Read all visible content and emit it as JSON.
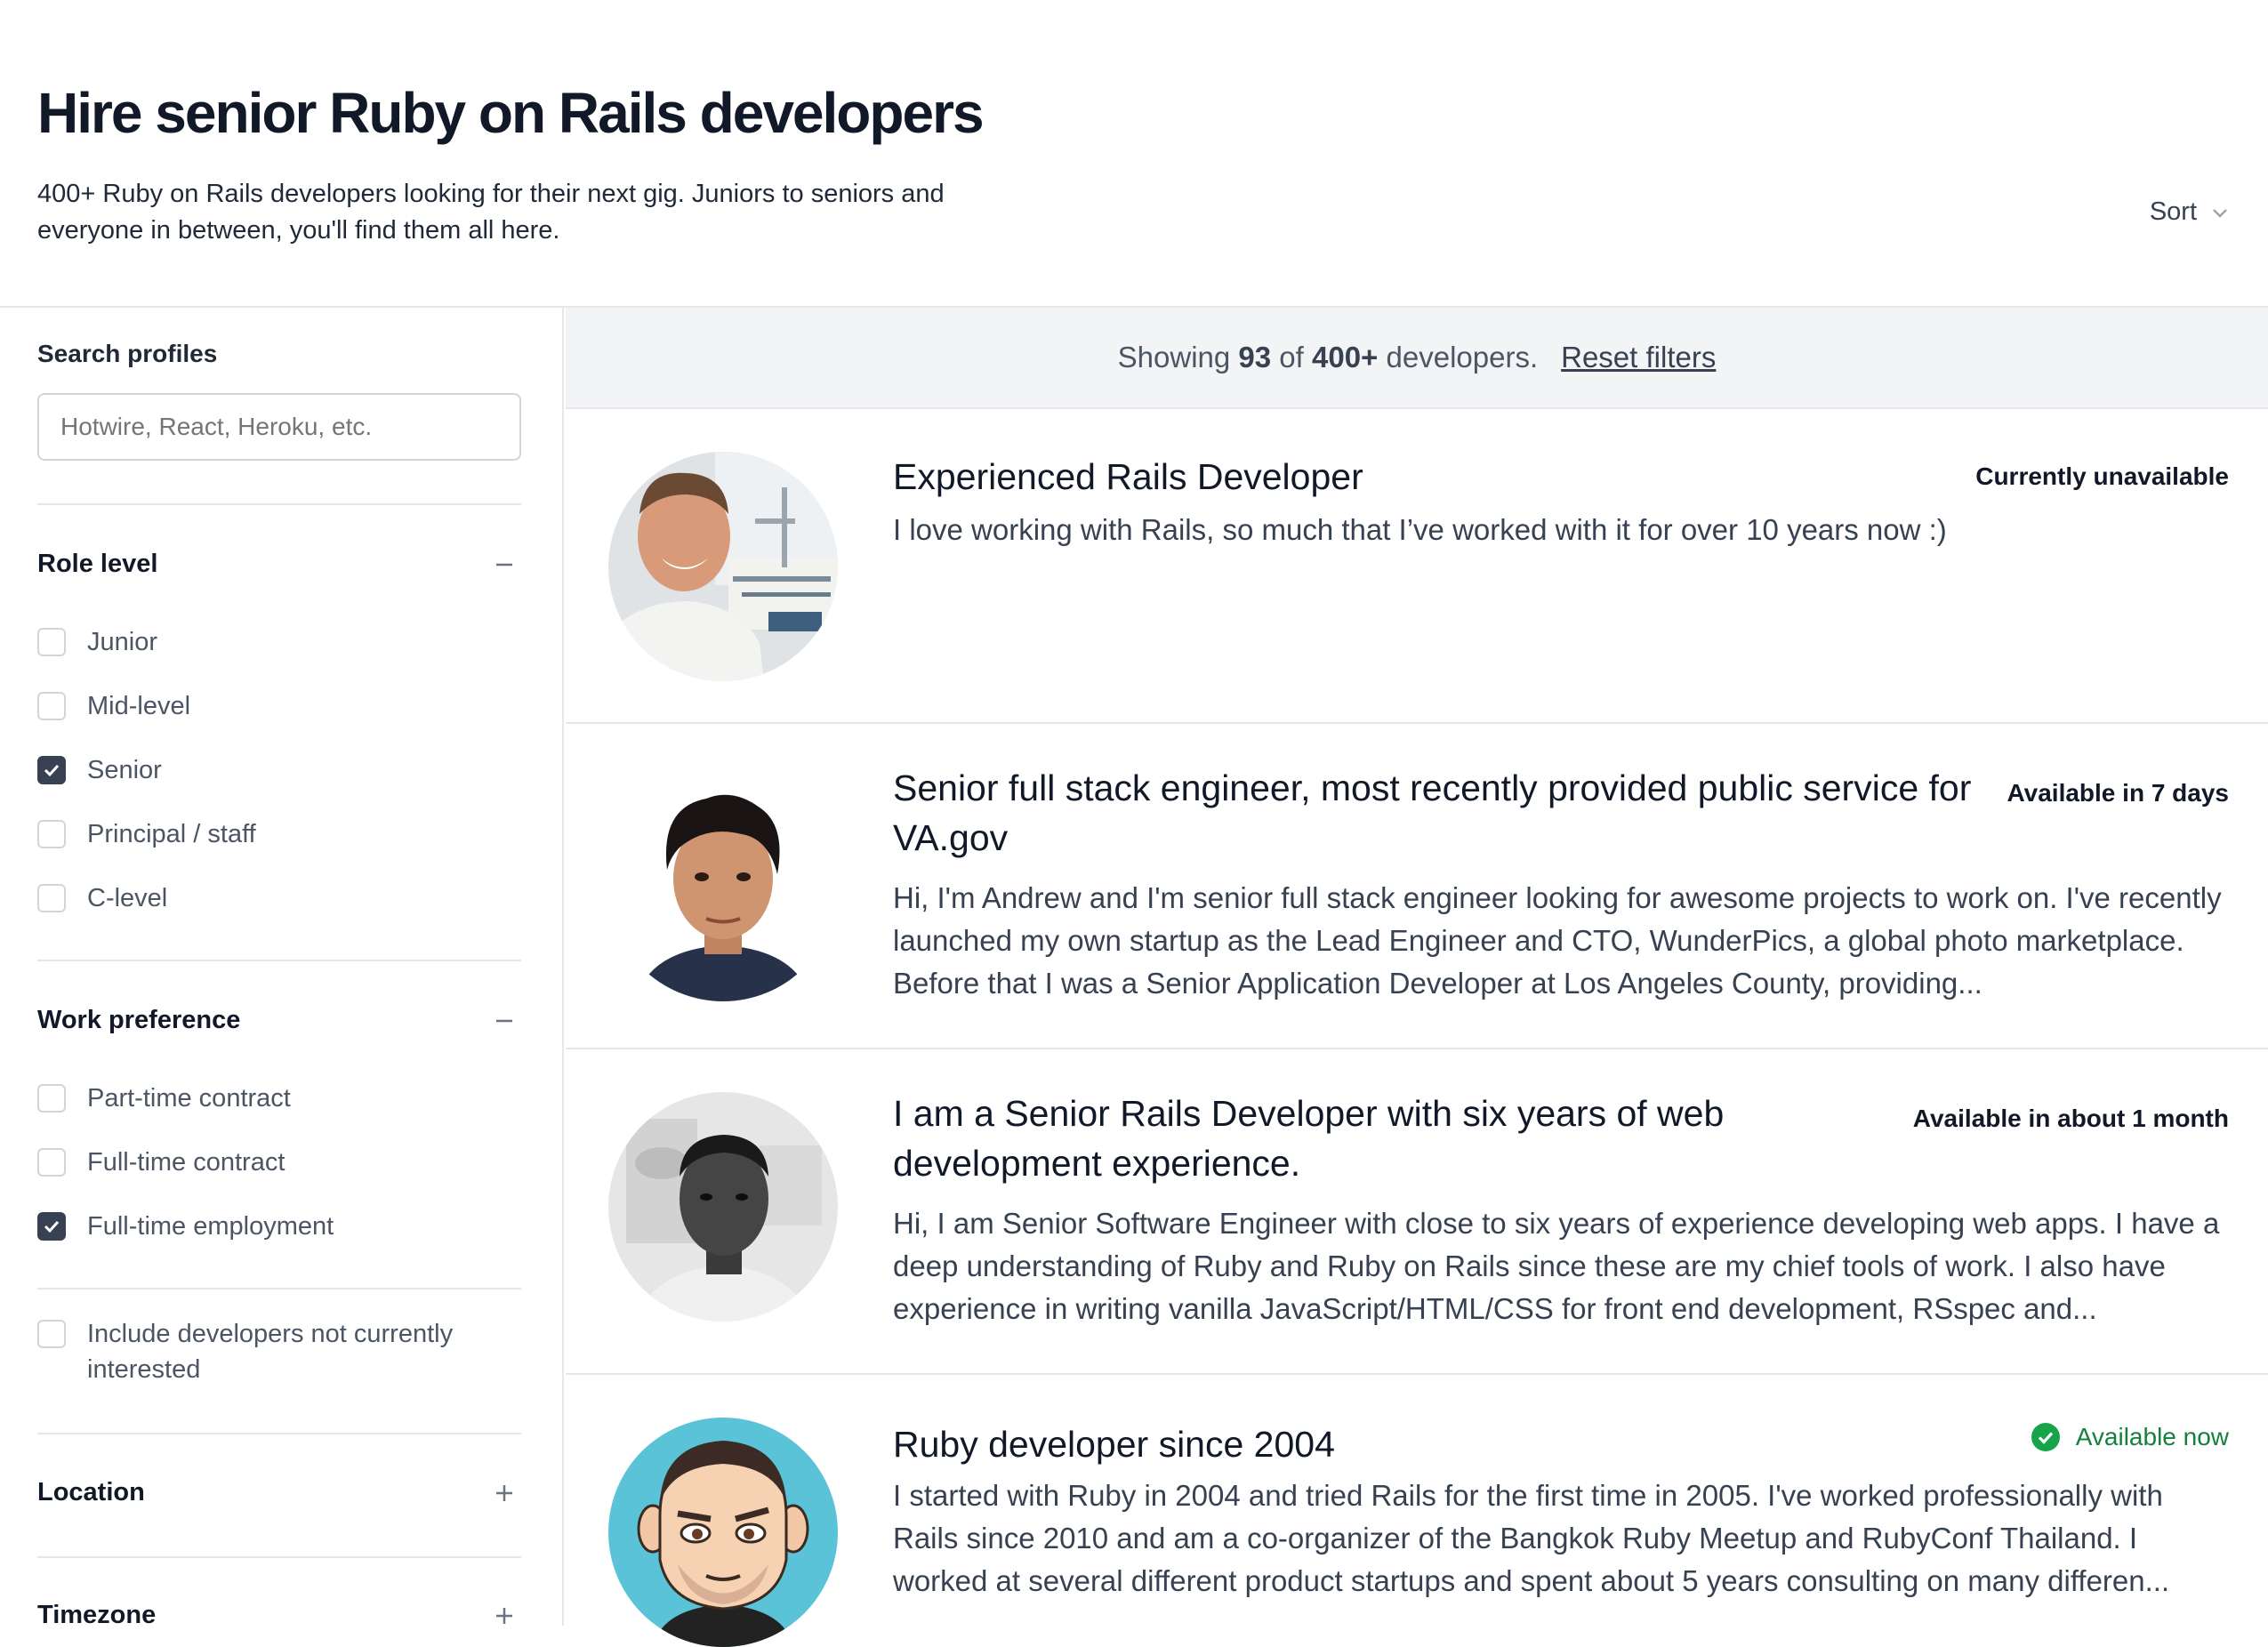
{
  "header": {
    "title": "Hire senior Ruby on Rails developers",
    "subtitle": "400+ Ruby on Rails developers looking for their next gig. Juniors to seniors and everyone in between, you'll find them all here.",
    "sort_label": "Sort"
  },
  "sidebar": {
    "search_label": "Search profiles",
    "search_placeholder": "Hotwire, React, Heroku, etc.",
    "role_level": {
      "title": "Role level",
      "options": [
        {
          "label": "Junior",
          "checked": false
        },
        {
          "label": "Mid-level",
          "checked": false
        },
        {
          "label": "Senior",
          "checked": true
        },
        {
          "label": "Principal / staff",
          "checked": false
        },
        {
          "label": "C-level",
          "checked": false
        }
      ]
    },
    "work_preference": {
      "title": "Work preference",
      "options": [
        {
          "label": "Part-time contract",
          "checked": false
        },
        {
          "label": "Full-time contract",
          "checked": false
        },
        {
          "label": "Full-time employment",
          "checked": true
        }
      ]
    },
    "include_not_interested": {
      "label": "Include developers not currently interested",
      "checked": false
    },
    "location_title": "Location",
    "timezone_title": "Timezone"
  },
  "summary": {
    "prefix": "Showing",
    "shown": "93",
    "of": "of",
    "total": "400+",
    "suffix": "developers.",
    "reset_label": "Reset filters"
  },
  "developers": [
    {
      "title": "Experienced Rails Developer",
      "status": "Currently unavailable",
      "description": "I love working with Rails, so much that I’ve worked with it for over 10 years now :)"
    },
    {
      "title": "Senior full stack engineer, most recently provided public service for VA.gov",
      "status": "Available in 7 days",
      "description": "Hi, I'm Andrew and I'm senior full stack engineer looking for awesome projects to work on. I've recently launched my own startup as the Lead Engineer and CTO, WunderPics, a global photo marketplace. Before that I was a Senior Application Developer at Los Angeles County, providing..."
    },
    {
      "title": "I am a Senior Rails Developer with six years of web development experience.",
      "status": "Available in about 1 month",
      "description": "Hi, I am Senior Software Engineer with close to six years of experience developing web apps. I have a deep understanding of Ruby and Ruby on Rails since these are my chief tools of work. I also have experience in writing vanilla JavaScript/HTML/CSS for front end development, RSspec and..."
    },
    {
      "title": "Ruby developer since 2004",
      "status": "Available now",
      "description": "I started with Ruby in 2004 and tried Rails for the first time in 2005. I've worked professionally with Rails since 2010 and am a co-organizer of the Bangkok Ruby Meetup and RubyConf Thailand. I worked at several different product startups and spent about 5 years consulting on many differen..."
    }
  ],
  "colors": {
    "available_green": "#16a34a",
    "checkbox_checked": "#374151"
  }
}
